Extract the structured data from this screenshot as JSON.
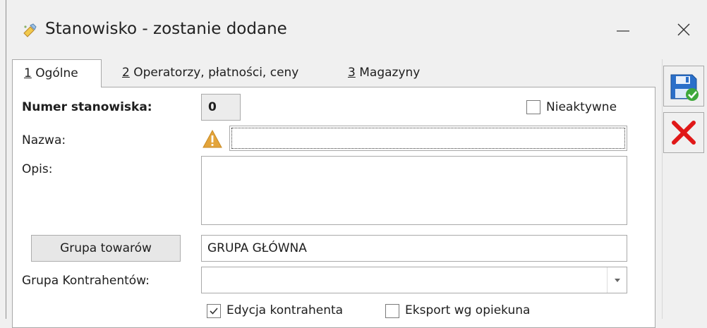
{
  "window": {
    "title": "Stanowisko - zostanie dodane",
    "minimize_icon": "minimize-icon",
    "close_icon": "close-icon"
  },
  "tabs": [
    {
      "key": "1",
      "label": " Ogólne",
      "active": true
    },
    {
      "key": "2",
      "label": " Operatorzy, płatności, ceny",
      "active": false
    },
    {
      "key": "3",
      "label": " Magazyny",
      "active": false
    }
  ],
  "form": {
    "numer_label": "Numer stanowiska:",
    "numer_value": "0",
    "nieaktywne_label": "Nieaktywne",
    "nieaktywne_checked": false,
    "nazwa_label": "Nazwa:",
    "nazwa_value": "",
    "opis_label": "Opis:",
    "opis_value": "",
    "grupa_towarow_button": "Grupa towarów",
    "grupa_towarow_value": "GRUPA GŁÓWNA",
    "grupa_kontrahentow_label": "Grupa Kontrahentów:",
    "grupa_kontrahentow_value": "",
    "edycja_label": "Edycja kontrahenta",
    "edycja_checked": true,
    "eksport_label": "Eksport wg opiekuna",
    "eksport_checked": false
  },
  "actions": {
    "save_icon": "save-icon",
    "cancel_icon": "cancel-icon"
  },
  "colors": {
    "save_blue": "#2a6fc9",
    "save_check": "#3ea83a",
    "cancel_red": "#e01818",
    "warning": "#e3a43a"
  }
}
